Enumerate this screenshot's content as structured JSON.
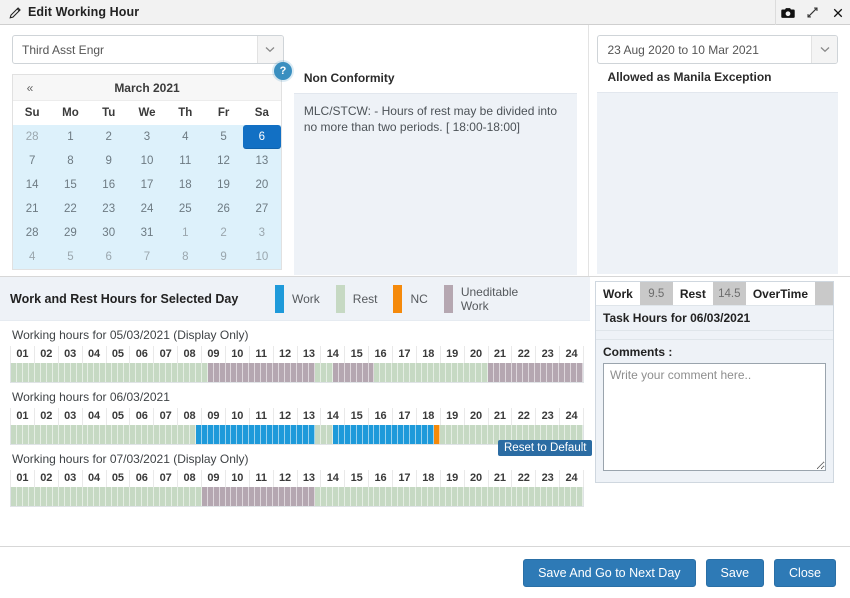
{
  "window": {
    "title": "Edit Working Hour",
    "edit_icon": "edit-pencil-icon",
    "actions": [
      {
        "name": "screenshot-button",
        "glyph": "camera-icon"
      },
      {
        "name": "expand-button",
        "glyph": "expand-icon"
      },
      {
        "name": "close-button",
        "glyph": "close-icon"
      }
    ]
  },
  "rank_select": {
    "value": "Third Asst Engr",
    "arrow": "chevron-down-icon"
  },
  "help": {
    "label": "?"
  },
  "period_select": {
    "value": "23 Aug 2020 to 10 Mar 2021",
    "arrow": "chevron-down-icon"
  },
  "calendar": {
    "prev_glyph": "«",
    "title": "March 2021",
    "dow": [
      "Su",
      "Mo",
      "Tu",
      "We",
      "Th",
      "Fr",
      "Sa"
    ],
    "weeks": [
      [
        {
          "d": "28",
          "m": "other"
        },
        {
          "d": "1",
          "m": "cur"
        },
        {
          "d": "2",
          "m": "cur"
        },
        {
          "d": "3",
          "m": "cur"
        },
        {
          "d": "4",
          "m": "cur"
        },
        {
          "d": "5",
          "m": "cur"
        },
        {
          "d": "6",
          "m": "sel"
        }
      ],
      [
        {
          "d": "7",
          "m": "cur"
        },
        {
          "d": "8",
          "m": "cur"
        },
        {
          "d": "9",
          "m": "cur"
        },
        {
          "d": "10",
          "m": "cur"
        },
        {
          "d": "11",
          "m": "cur"
        },
        {
          "d": "12",
          "m": "cur"
        },
        {
          "d": "13",
          "m": "cur"
        }
      ],
      [
        {
          "d": "14",
          "m": "cur"
        },
        {
          "d": "15",
          "m": "cur"
        },
        {
          "d": "16",
          "m": "cur"
        },
        {
          "d": "17",
          "m": "cur"
        },
        {
          "d": "18",
          "m": "cur"
        },
        {
          "d": "19",
          "m": "cur"
        },
        {
          "d": "20",
          "m": "cur"
        }
      ],
      [
        {
          "d": "21",
          "m": "cur"
        },
        {
          "d": "22",
          "m": "cur"
        },
        {
          "d": "23",
          "m": "cur"
        },
        {
          "d": "24",
          "m": "cur"
        },
        {
          "d": "25",
          "m": "cur"
        },
        {
          "d": "26",
          "m": "cur"
        },
        {
          "d": "27",
          "m": "cur"
        }
      ],
      [
        {
          "d": "28",
          "m": "cur"
        },
        {
          "d": "29",
          "m": "cur"
        },
        {
          "d": "30",
          "m": "cur"
        },
        {
          "d": "31",
          "m": "cur"
        },
        {
          "d": "1",
          "m": "other"
        },
        {
          "d": "2",
          "m": "other"
        },
        {
          "d": "3",
          "m": "other"
        }
      ],
      [
        {
          "d": "4",
          "m": "other"
        },
        {
          "d": "5",
          "m": "other"
        },
        {
          "d": "6",
          "m": "other"
        },
        {
          "d": "7",
          "m": "other"
        },
        {
          "d": "8",
          "m": "other"
        },
        {
          "d": "9",
          "m": "other"
        },
        {
          "d": "10",
          "m": "other"
        }
      ]
    ]
  },
  "non_conformity": {
    "title": "Non Conformity",
    "text": "MLC/STCW: - Hours of rest may be divided into no more than two periods. [ 18:00-18:00]"
  },
  "manila": {
    "title": "Allowed as Manila Exception",
    "text": ""
  },
  "hours_section": {
    "title": "Work and Rest Hours for Selected Day",
    "legend": [
      {
        "label": "Work",
        "color": "#1e9ada"
      },
      {
        "label": "Rest",
        "color": "#c6d9c3"
      },
      {
        "label": "NC",
        "color": "#f58a0b"
      },
      {
        "label": "Uneditable Work",
        "color": "#b5a7b1"
      }
    ],
    "hour_ticks": [
      "01",
      "02",
      "03",
      "04",
      "05",
      "06",
      "07",
      "08",
      "09",
      "10",
      "11",
      "12",
      "13",
      "14",
      "15",
      "16",
      "17",
      "18",
      "19",
      "20",
      "21",
      "22",
      "23",
      "24"
    ],
    "tooltip": "Reset to Default",
    "rows": [
      {
        "label": "Working hours for 05/03/2021 (Display Only)",
        "editable": false,
        "segments": [
          {
            "type": "rest",
            "from": 0,
            "to": 33
          },
          {
            "type": "uneditable",
            "from": 33,
            "to": 51
          },
          {
            "type": "rest",
            "from": 51,
            "to": 54
          },
          {
            "type": "uneditable",
            "from": 54,
            "to": 61
          },
          {
            "type": "rest",
            "from": 61,
            "to": 80
          },
          {
            "type": "uneditable",
            "from": 80,
            "to": 96
          }
        ]
      },
      {
        "label": "Working hours for 06/03/2021",
        "editable": true,
        "segments": [
          {
            "type": "rest",
            "from": 0,
            "to": 31
          },
          {
            "type": "work",
            "from": 31,
            "to": 51
          },
          {
            "type": "rest",
            "from": 51,
            "to": 54
          },
          {
            "type": "work",
            "from": 54,
            "to": 71
          },
          {
            "type": "nc",
            "from": 71,
            "to": 72
          },
          {
            "type": "rest",
            "from": 72,
            "to": 96
          }
        ]
      },
      {
        "label": "Working hours for 07/03/2021 (Display Only)",
        "editable": false,
        "segments": [
          {
            "type": "rest",
            "from": 0,
            "to": 32
          },
          {
            "type": "uneditable",
            "from": 32,
            "to": 51
          },
          {
            "type": "rest",
            "from": 51,
            "to": 96
          }
        ]
      }
    ]
  },
  "summary": {
    "work_label": "Work",
    "work_value": "9.5",
    "rest_label": "Rest",
    "rest_value": "14.5",
    "overtime_label": "OverTime",
    "overtime_value": "",
    "task_hours_title": "Task Hours for 06/03/2021",
    "comments_label": "Comments :",
    "comment_value": "",
    "comment_placeholder": "Write your comment here.."
  },
  "footer": {
    "save_next_label": "Save And Go to Next Day",
    "save_label": "Save",
    "close_label": "Close"
  }
}
